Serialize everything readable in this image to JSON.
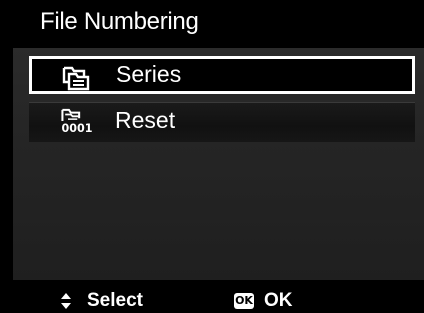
{
  "screen": {
    "title": "File Numbering"
  },
  "menu": {
    "items": [
      {
        "label": "Series",
        "icon": "folder-series-icon",
        "selected": true
      },
      {
        "label": "Reset",
        "icon": "folder-reset-0001-icon",
        "selected": false
      }
    ],
    "reset_icon_text": "0001"
  },
  "footer": {
    "select_label": "Select",
    "ok_badge": "OK",
    "ok_label": "OK"
  },
  "colors": {
    "background": "#000000",
    "panel": "#262626",
    "text": "#ffffff",
    "selection_border": "#ffffff"
  }
}
